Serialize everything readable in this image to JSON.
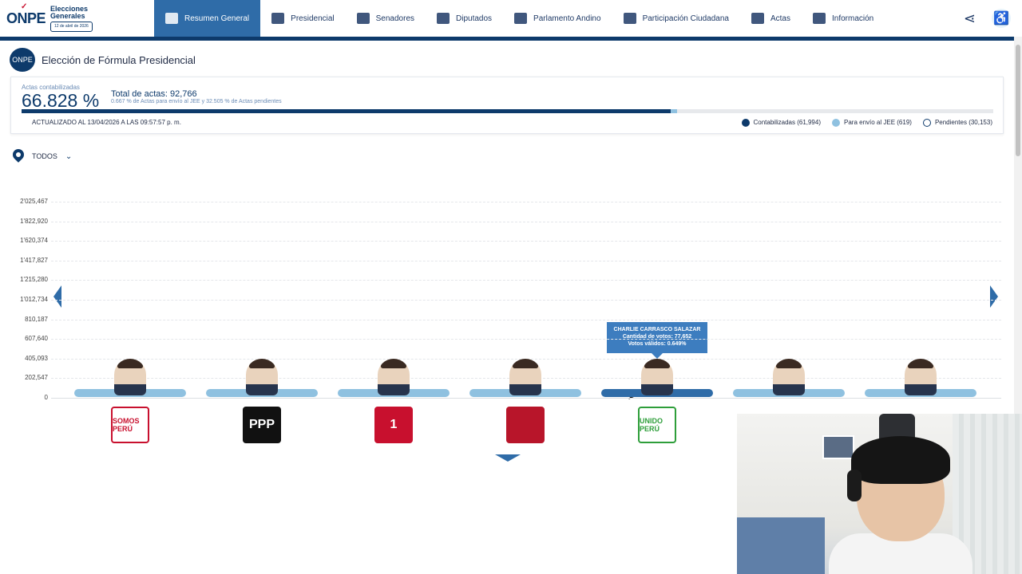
{
  "nav": {
    "logo": "ONPE",
    "logo_title": "Elecciones Generales",
    "logo_date": "12 de abril de 2026",
    "items": [
      {
        "label": "Resumen General",
        "active": true
      },
      {
        "label": "Presidencial"
      },
      {
        "label": "Senadores"
      },
      {
        "label": "Diputados"
      },
      {
        "label": "Parlamento Andino"
      },
      {
        "label": "Participación Ciudadana"
      },
      {
        "label": "Actas"
      },
      {
        "label": "Información"
      }
    ]
  },
  "page": {
    "title": "Elección de Fórmula Presidencial",
    "seal_text": "ONPE"
  },
  "progress": {
    "label": "Actas contabilizadas",
    "percent": "66.828 %",
    "total": "Total de actas: 92,766",
    "sub": "0.667 % de Actas para envío al JEE y 32.505 % de Actas pendientes",
    "updated": "ACTUALIZADO AL 13/04/2026 A LAS 09:57:57 p. m.",
    "fill_counted_pct": 66.828,
    "fill_jee_pct": 0.667,
    "legend": [
      {
        "label": "Contabilizadas (61,994)",
        "color": "#0d3a6b"
      },
      {
        "label": "Para envío al JEE (619)",
        "color": "#8fc1e0"
      },
      {
        "label": "Pendientes (30,153)",
        "color": "#ffffff"
      }
    ]
  },
  "filter": {
    "label": "TODOS"
  },
  "chart_data": {
    "type": "bar",
    "y_ticks": [
      "2'025,467",
      "1'822,920",
      "1'620,374",
      "1'417,827",
      "1'215,280",
      "1'012,734",
      "810,187",
      "607,640",
      "405,093",
      "202,547",
      "0"
    ],
    "ylim": [
      0,
      2025467
    ],
    "candidates": [
      {
        "party": "SOMOS PERÚ",
        "party_color": "#c8102e",
        "party_bg": "#ffffff"
      },
      {
        "party": "PPP",
        "party_color": "#ffffff",
        "party_bg": "#111111"
      },
      {
        "party": "1",
        "party_color": "#ffffff",
        "party_bg": "#c8102e"
      },
      {
        "party": "",
        "party_color": "#2e7d32",
        "party_bg": "#b8152a"
      },
      {
        "party": "UNIDO PERÚ",
        "party_color": "#2e9e3a",
        "party_bg": "#ffffff",
        "highlighted": true
      },
      {
        "party": "",
        "party_color": "#c8102e",
        "party_bg": "#ffffff"
      },
      {
        "party": "",
        "party_color": "#c8102e",
        "party_bg": "#ffffff"
      }
    ],
    "tooltip": {
      "name": "CHARLIE CARRASCO SALAZAR",
      "votes": "Cantidad de votos: 77,652",
      "valid": "Votos válidos: 0.649%"
    }
  }
}
